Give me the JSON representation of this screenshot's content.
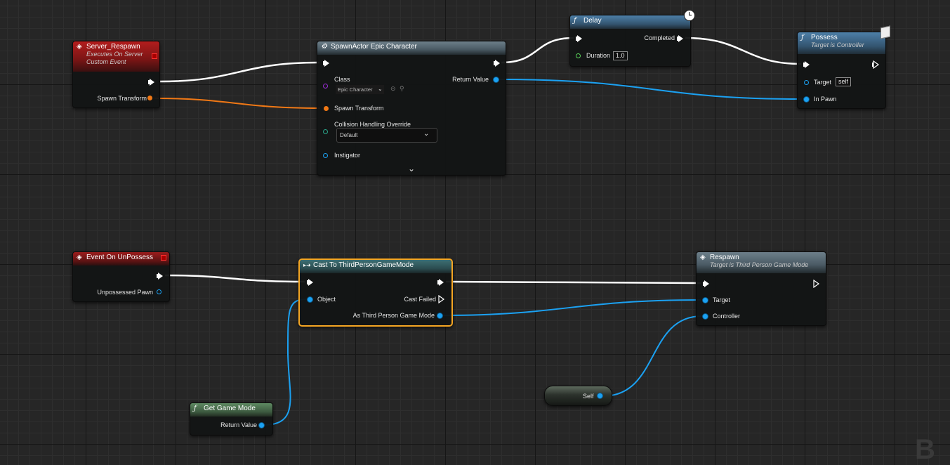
{
  "nodes": {
    "server_respawn": {
      "title": "Server_Respawn",
      "sub1": "Executes On Server",
      "sub2": "Custom Event",
      "spawn_transform": "Spawn Transform"
    },
    "spawn_actor": {
      "title": "SpawnActor Epic Character",
      "class_label": "Class",
      "class_value": "Epic Character",
      "return_value": "Return Value",
      "spawn_transform": "Spawn Transform",
      "collision_label": "Collision Handling Override",
      "collision_value": "Default",
      "instigator": "Instigator"
    },
    "delay": {
      "title": "Delay",
      "completed": "Completed",
      "duration_label": "Duration",
      "duration_value": "1.0"
    },
    "possess": {
      "title": "Possess",
      "subtitle": "Target is Controller",
      "target": "Target",
      "target_value": "self",
      "in_pawn": "In Pawn"
    },
    "event_unpossess": {
      "title": "Event On UnPossess",
      "unpossessed_pawn": "Unpossessed Pawn"
    },
    "cast": {
      "title": "Cast To ThirdPersonGameMode",
      "object": "Object",
      "cast_failed": "Cast Failed",
      "as_output": "As Third Person Game Mode"
    },
    "respawn": {
      "title": "Respawn",
      "subtitle": "Target is Third Person Game Mode",
      "target": "Target",
      "controller": "Controller"
    },
    "get_game_mode": {
      "title": "Get Game Mode",
      "return_value": "Return Value"
    },
    "self_node": {
      "label": "Self"
    }
  },
  "colors": {
    "exec": "#ffffff",
    "object_pin": "#1ba1f2",
    "struct_pin": "#f07815",
    "float_pin": "#5ad25a",
    "class_pin": "#9a2bd6",
    "event_header": "#b31d1d",
    "selected_border": "#f5a623"
  },
  "icons": [
    "event-diamond-icon",
    "function-icon",
    "clock-icon",
    "network-icon",
    "cast-icon",
    "chevron-down-icon"
  ]
}
